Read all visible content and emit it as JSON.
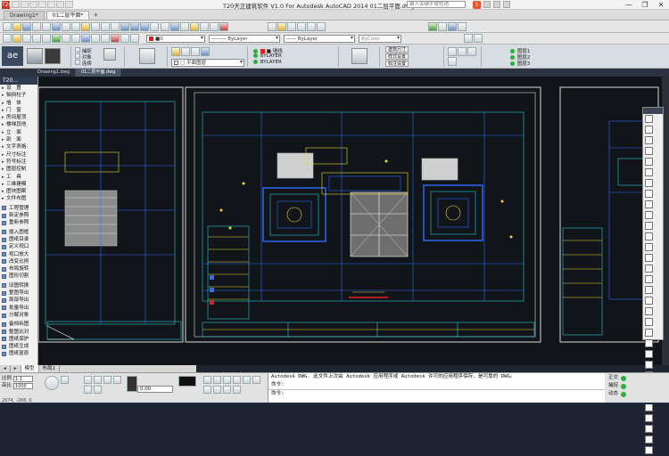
{
  "titlebar": {
    "app_icon": "T20",
    "title": "T20天正建筑软件 V1.0 For Autodesk AutoCAD 2014    01二层平面.dwg",
    "search_placeholder": "键入关键字或短语",
    "sogou": "S",
    "window_controls": [
      "—",
      "❐",
      "✕"
    ]
  },
  "doc_tabs": {
    "tabs": [
      "Drawing1*",
      "01二层平面*"
    ],
    "plus": "+"
  },
  "toolbar2": {
    "layer_dropdown": "■0",
    "linetype_dropdown": "———  ByLayer",
    "lineweight_dropdown": "——  ByLayer",
    "plotstyle_dropdown": "ByColor"
  },
  "ribbon": {
    "logo": "ae",
    "group1_items": [
      "捕捉",
      "对象",
      "连续"
    ],
    "layer_combo": "■ 墙线",
    "layer_combo2": "□ 平面图层",
    "bylayer_items": [
      "ByLayer",
      "BYLAYER",
      "BYLAYER"
    ],
    "btns": [
      "建筑尺寸",
      "样式设置",
      "标注设置"
    ],
    "right_items": [
      "图层1",
      "图层2",
      "图层3"
    ]
  },
  "file_tabs": [
    "Drawing1.dwg",
    "01二层平面.dwg"
  ],
  "left_panel": {
    "header": "T20...",
    "items": [
      {
        "arrow": "▸",
        "label": "设　置"
      },
      {
        "arrow": "▸",
        "label": "轴网柱子"
      },
      {
        "arrow": "▸",
        "label": "墙　体"
      },
      {
        "arrow": "▸",
        "label": "门　窗"
      },
      {
        "arrow": "▸",
        "label": "房间屋顶"
      },
      {
        "arrow": "▸",
        "label": "楼梯其他"
      },
      {
        "arrow": "▸",
        "label": "立　面"
      },
      {
        "arrow": "▸",
        "label": "剖　面"
      },
      {
        "arrow": "▸",
        "label": "文字表格"
      },
      {
        "arrow": "▸",
        "label": "尺寸标注"
      },
      {
        "arrow": "▸",
        "label": "符号标注"
      },
      {
        "arrow": "▸",
        "label": "图层控制"
      },
      {
        "arrow": "▸",
        "label": "工　具"
      },
      {
        "arrow": "▸",
        "label": "三维建模"
      },
      {
        "arrow": "▸",
        "label": "图块图案"
      },
      {
        "arrow": "▸",
        "label": "文件布图"
      }
    ],
    "tools": [
      "工程管理",
      "新定参照",
      "重新参照",
      "插入图框",
      "图纸目录",
      "定义视口",
      "视口放大",
      "改变比例",
      "布局旋转",
      "图形切割",
      "旧图转换",
      "整图导出",
      "局部导出",
      "批量导出",
      "分解对象",
      "备档拆图",
      "整图比对",
      "图纸保护",
      "图纸生成",
      "图纸复原"
    ]
  },
  "layout_tabs": [
    "◂",
    "▸",
    "模型",
    "布局1"
  ],
  "bottom": {
    "scale_label": "比例",
    "scale_value": "1:1",
    "height_label": "高比",
    "height_value": "1000",
    "coords": "2074, -268, 0",
    "field_value": "0.00",
    "command_lines": [
      "Autodesk DWG.  此文件上次由 Autodesk 应用程序或 Autodesk 许可的应用程序保存，是可靠的 DWG。",
      "命令:",
      "命令:"
    ],
    "status_right": [
      {
        "label": "正交"
      },
      {
        "label": "捕捉"
      },
      {
        "label": "动态"
      }
    ]
  }
}
